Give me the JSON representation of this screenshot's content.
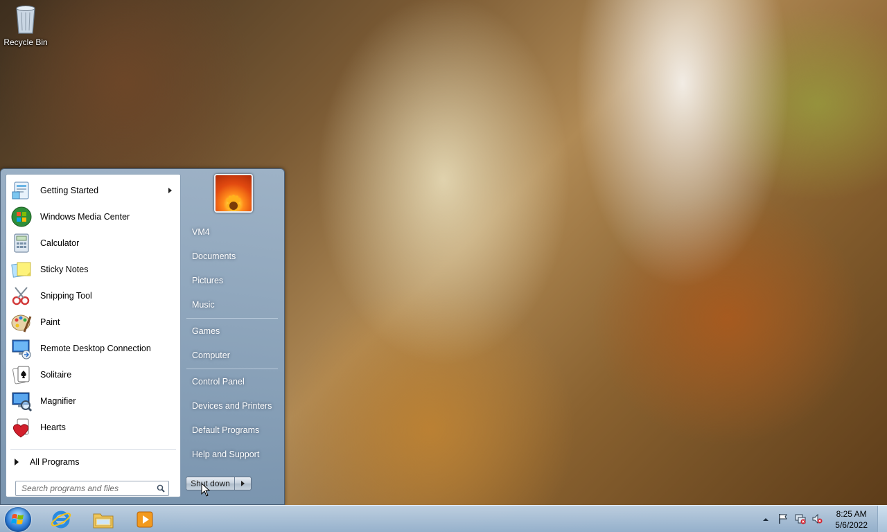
{
  "desktop": {
    "recycle_bin_label": "Recycle Bin"
  },
  "start_menu": {
    "programs": [
      {
        "label": "Getting Started",
        "icon": "getting-started-icon",
        "has_submenu": true
      },
      {
        "label": "Windows Media Center",
        "icon": "media-center-icon"
      },
      {
        "label": "Calculator",
        "icon": "calculator-icon"
      },
      {
        "label": "Sticky Notes",
        "icon": "sticky-notes-icon"
      },
      {
        "label": "Snipping Tool",
        "icon": "snipping-tool-icon"
      },
      {
        "label": "Paint",
        "icon": "paint-icon"
      },
      {
        "label": "Remote Desktop Connection",
        "icon": "remote-desktop-icon"
      },
      {
        "label": "Solitaire",
        "icon": "solitaire-icon"
      },
      {
        "label": "Magnifier",
        "icon": "magnifier-icon"
      },
      {
        "label": "Hearts",
        "icon": "hearts-icon"
      }
    ],
    "all_programs_label": "All Programs",
    "search_placeholder": "Search programs and files",
    "right_items": [
      {
        "label": "VM4"
      },
      {
        "label": "Documents"
      },
      {
        "label": "Pictures"
      },
      {
        "label": "Music"
      },
      {
        "label": "Games"
      },
      {
        "label": "Computer"
      },
      {
        "label": "Control Panel"
      },
      {
        "label": "Devices and Printers"
      },
      {
        "label": "Default Programs"
      },
      {
        "label": "Help and Support"
      }
    ],
    "shutdown_label": "Shut down"
  },
  "taskbar": {
    "pinned": [
      "internet-explorer-icon",
      "windows-explorer-icon",
      "media-player-icon"
    ],
    "tray_icons": [
      "show-hidden-icons-icon",
      "action-center-flag-icon",
      "network-icon",
      "volume-muted-icon"
    ],
    "clock_time": "8:25 AM",
    "clock_date": "5/6/2022"
  },
  "colors": {
    "taskbar": "#a9c3dc",
    "start_menu_frame": "#8fa9c4",
    "orb_blue": "#2f7ed8"
  }
}
